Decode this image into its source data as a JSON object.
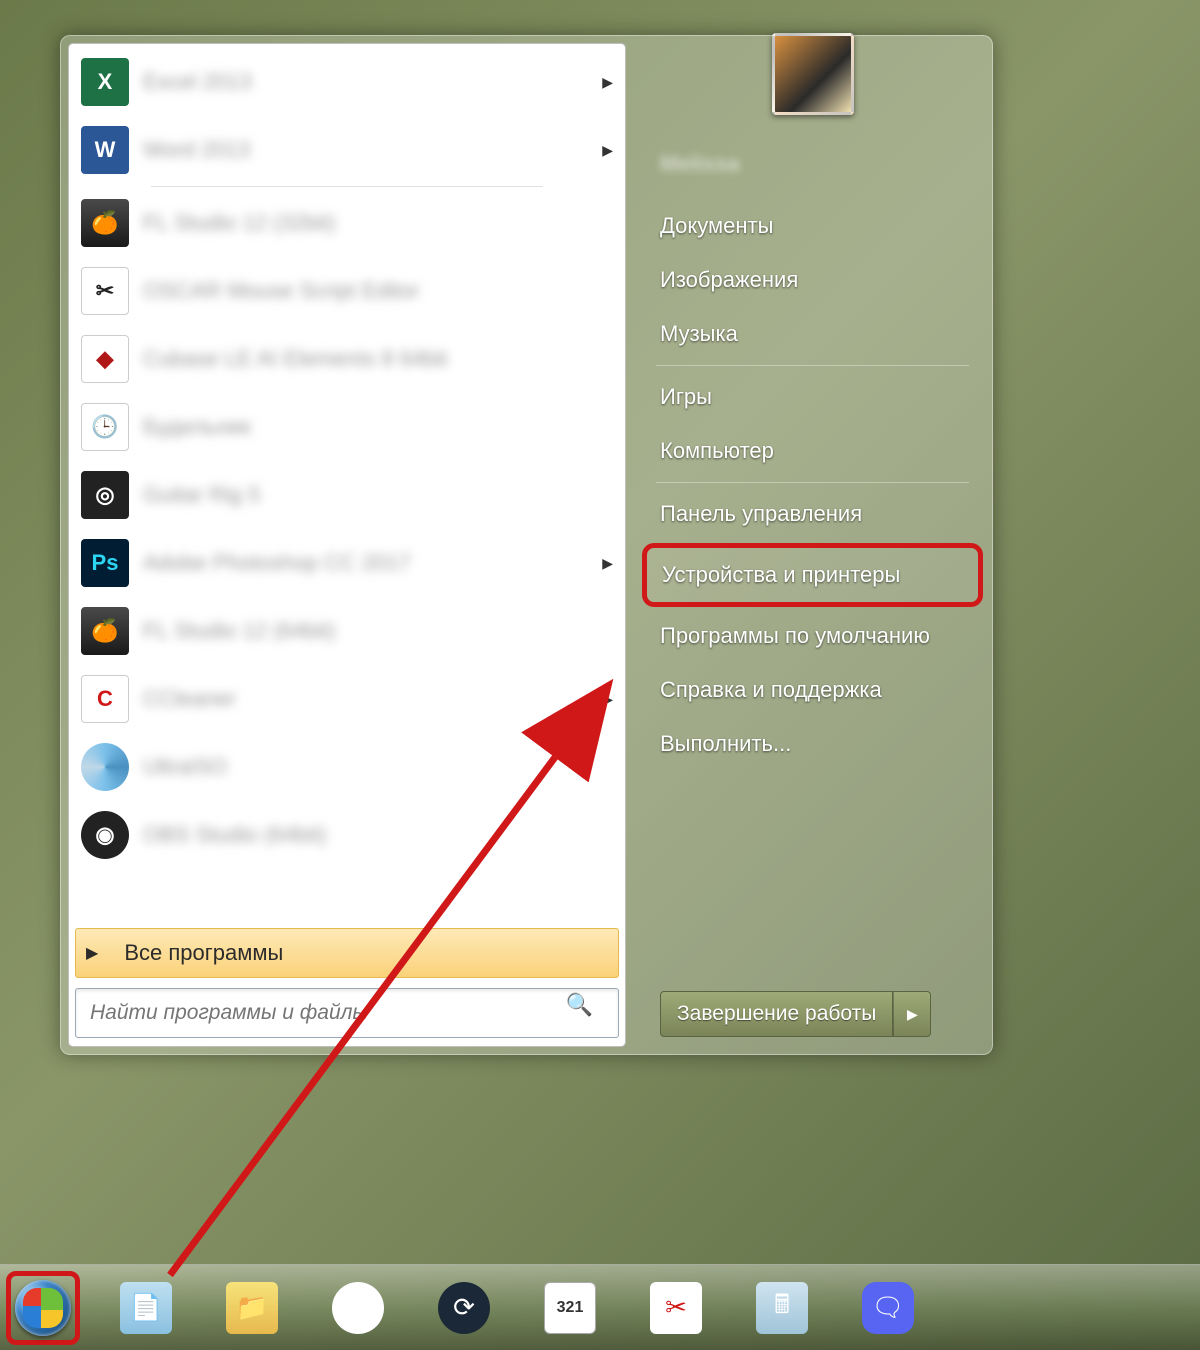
{
  "user_name": "Melissa",
  "programs": [
    {
      "label": "Excel 2013",
      "icon": "ic-excel",
      "glyph": "X",
      "name": "prog-excel",
      "arrow": true
    },
    {
      "label": "Word 2013",
      "icon": "ic-word",
      "glyph": "W",
      "name": "prog-word",
      "arrow": true
    },
    {
      "label": "FL Studio 12 (32bit)",
      "icon": "ic-fl",
      "glyph": "🍊",
      "name": "prog-flstudio32",
      "arrow": false
    },
    {
      "label": "OSCAR Mouse Script Editor",
      "icon": "ic-oscar",
      "glyph": "✂",
      "name": "prog-oscar",
      "arrow": false
    },
    {
      "label": "Cubase LE AI Elements 8 64bit",
      "icon": "ic-cubase",
      "glyph": "◆",
      "name": "prog-cubase",
      "arrow": false
    },
    {
      "label": "Будильник",
      "icon": "ic-clock",
      "glyph": "🕒",
      "name": "prog-alarm",
      "arrow": false
    },
    {
      "label": "Guitar Rig 5",
      "icon": "ic-guitar",
      "glyph": "◎",
      "name": "prog-guitarrig",
      "arrow": false
    },
    {
      "label": "Adobe Photoshop CC 2017",
      "icon": "ic-ps",
      "glyph": "Ps",
      "name": "prog-photoshop",
      "arrow": true
    },
    {
      "label": "FL Studio 12 (64bit)",
      "icon": "ic-fl2",
      "glyph": "🍊",
      "name": "prog-flstudio64",
      "arrow": false
    },
    {
      "label": "CCleaner",
      "icon": "ic-cc",
      "glyph": "C",
      "name": "prog-ccleaner",
      "arrow": true
    },
    {
      "label": "UltraISO",
      "icon": "ic-iso",
      "glyph": "",
      "name": "prog-ultraiso",
      "arrow": false
    },
    {
      "label": "OBS Studio (64bit)",
      "icon": "ic-obs",
      "glyph": "◉",
      "name": "prog-obs",
      "arrow": false
    }
  ],
  "all_programs_label": "Все программы",
  "search_placeholder": "Найти программы и файлы",
  "right_items": [
    {
      "label": "Документы",
      "name": "nav-documents"
    },
    {
      "label": "Изображения",
      "name": "nav-pictures"
    },
    {
      "label": "Музыка",
      "name": "nav-music"
    },
    {
      "sep": true
    },
    {
      "label": "Игры",
      "name": "nav-games"
    },
    {
      "label": "Компьютер",
      "name": "nav-computer"
    },
    {
      "sep": true
    },
    {
      "label": "Панель управления",
      "name": "nav-control-panel"
    },
    {
      "label": "Устройства и принтеры",
      "name": "nav-devices-printers",
      "highlight": true
    },
    {
      "label": "Программы по умолчанию",
      "name": "nav-default-programs"
    },
    {
      "label": "Справка и поддержка",
      "name": "nav-help"
    },
    {
      "label": "Выполнить...",
      "name": "nav-run"
    }
  ],
  "shutdown_label": "Завершение работы",
  "taskbar": [
    {
      "name": "tb-notepad",
      "cls": "tbi-note",
      "glyph": "📄"
    },
    {
      "name": "tb-explorer",
      "cls": "tbi-exp",
      "glyph": "📁"
    },
    {
      "name": "tb-chrome",
      "cls": "tbi-chrome",
      "glyph": "◉"
    },
    {
      "name": "tb-steam",
      "cls": "tbi-steam",
      "glyph": "⟳"
    },
    {
      "name": "tb-mpc",
      "cls": "tbi-mpc",
      "glyph": "321"
    },
    {
      "name": "tb-snip",
      "cls": "tbi-snip",
      "glyph": "✂"
    },
    {
      "name": "tb-calc",
      "cls": "tbi-calc",
      "glyph": "🖩"
    },
    {
      "name": "tb-discord",
      "cls": "tbi-disc",
      "glyph": "🗨"
    }
  ]
}
